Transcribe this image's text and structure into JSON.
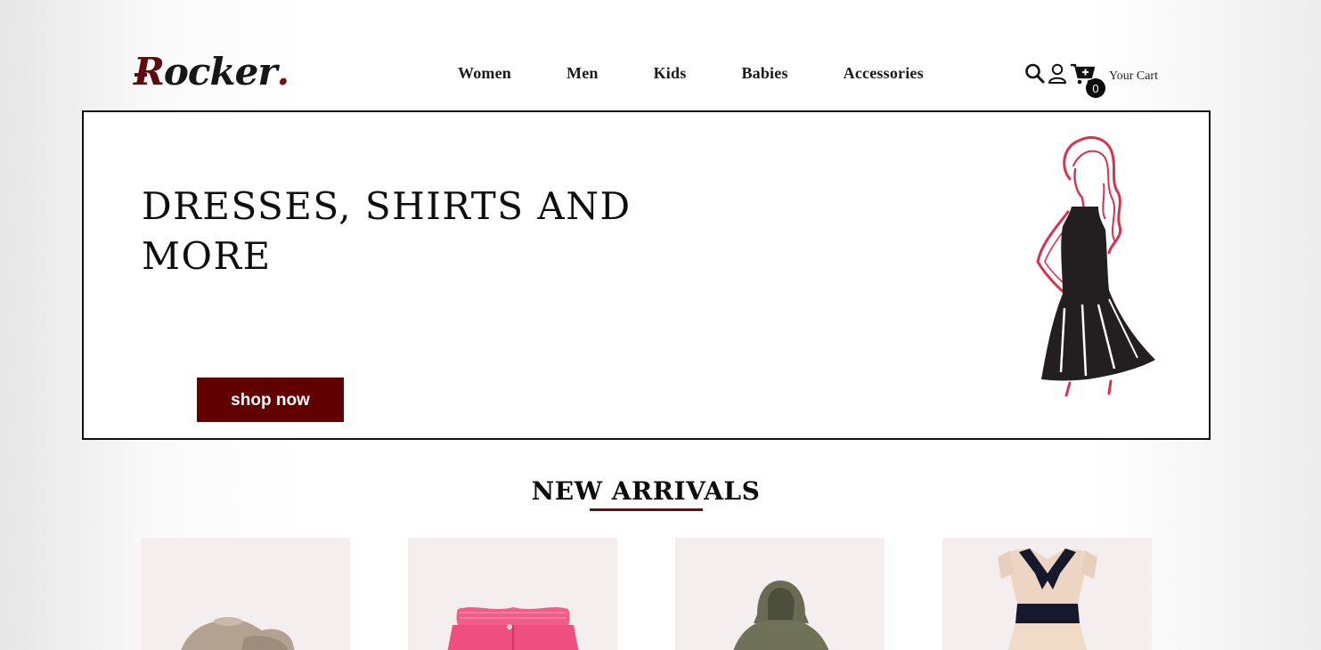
{
  "brand": {
    "name_first": "R",
    "name_rest": "ocker",
    "name_dot": "."
  },
  "nav": {
    "items": [
      {
        "label": "Women"
      },
      {
        "label": "Men"
      },
      {
        "label": "Kids"
      },
      {
        "label": "Babies"
      },
      {
        "label": "Accessories"
      }
    ]
  },
  "header": {
    "icons": [
      "search-icon",
      "user-icon",
      "cart-icon"
    ],
    "cart_count": "0",
    "cart_label": "Your Cart"
  },
  "hero": {
    "title_line1": "DRESSES, SHIRTS AND",
    "title_line2": "MORE",
    "button_label": "shop now",
    "image": "woman-in-black-dress-illustration"
  },
  "new_arrivals": {
    "title": "NEW ARRIVALS",
    "products": [
      {
        "image": "beige-knit-sweater"
      },
      {
        "image": "pink-paperbag-shorts"
      },
      {
        "image": "olive-green-hoodie"
      },
      {
        "image": "beige-dress-with-navy-collar"
      }
    ]
  },
  "colors": {
    "accent": "#600000",
    "brand_red": "#5c0b0e",
    "card_bg": "#f4eeef",
    "hero_border": "#111111"
  }
}
